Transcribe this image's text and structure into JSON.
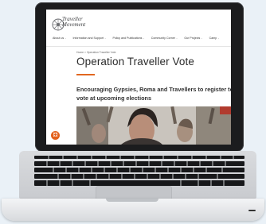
{
  "site": {
    "logo_text": "Traveller\nMovement",
    "nav": [
      "About us",
      "Information and Support",
      "Policy and Publications",
      "Community Corner",
      "Our Projects",
      "Camp"
    ],
    "breadcrumb": "Home > Operation Traveller Vote",
    "title": "Operation Traveller Vote",
    "subtitle": "Encouraging Gypsies, Roma and Travellers to register to vote at upcoming elections"
  },
  "colors": {
    "accent": "#e1671f",
    "laptop_body": "#d9dbde",
    "bezel": "#1b1c1e"
  },
  "icons": {
    "accessibility": "accessibility-icon"
  }
}
